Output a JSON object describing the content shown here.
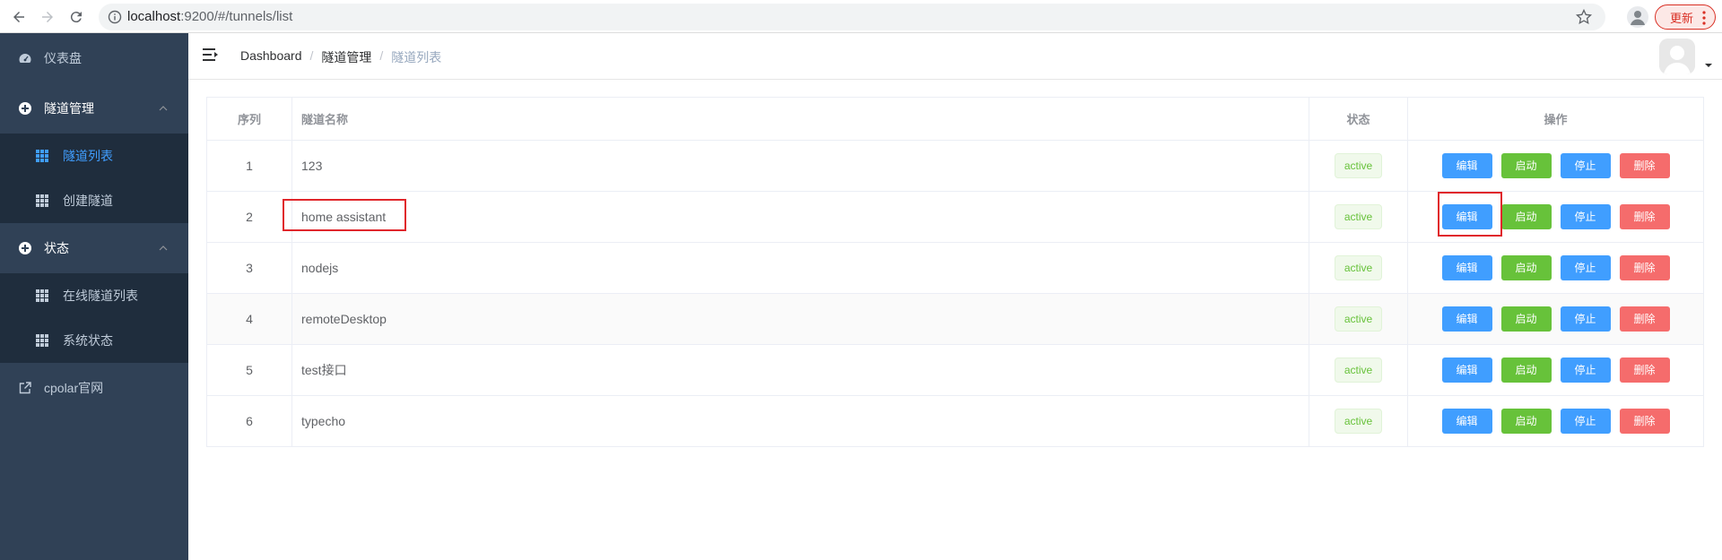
{
  "browser": {
    "url_host": "localhost",
    "url_rest": ":9200/#/tunnels/list",
    "update_label": "更新"
  },
  "sidebar": {
    "items": [
      {
        "label": "仪表盘"
      },
      {
        "label": "隧道管理"
      },
      {
        "label": "隧道列表"
      },
      {
        "label": "创建隧道"
      },
      {
        "label": "状态"
      },
      {
        "label": "在线隧道列表"
      },
      {
        "label": "系统状态"
      },
      {
        "label": "cpolar官网"
      }
    ]
  },
  "header": {
    "breadcrumb": [
      "Dashboard",
      "隧道管理",
      "隧道列表"
    ]
  },
  "table": {
    "headers": [
      "序列",
      "隧道名称",
      "状态",
      "操作"
    ],
    "actions": [
      "编辑",
      "启动",
      "停止",
      "删除"
    ],
    "rows": [
      {
        "index": "1",
        "name": "123",
        "status": "active"
      },
      {
        "index": "2",
        "name": "home assistant",
        "status": "active"
      },
      {
        "index": "3",
        "name": "nodejs",
        "status": "active"
      },
      {
        "index": "4",
        "name": "remoteDesktop",
        "status": "active"
      },
      {
        "index": "5",
        "name": "test接口",
        "status": "active"
      },
      {
        "index": "6",
        "name": "typecho",
        "status": "active"
      }
    ]
  },
  "colors": {
    "sidebar_bg": "#304156",
    "submenu_bg": "#1f2d3d",
    "active_link": "#409eff",
    "edit": "#409eff",
    "start": "#67c23a",
    "stop": "#409eff",
    "delete": "#f56c6c",
    "highlight": "#e0262b"
  }
}
